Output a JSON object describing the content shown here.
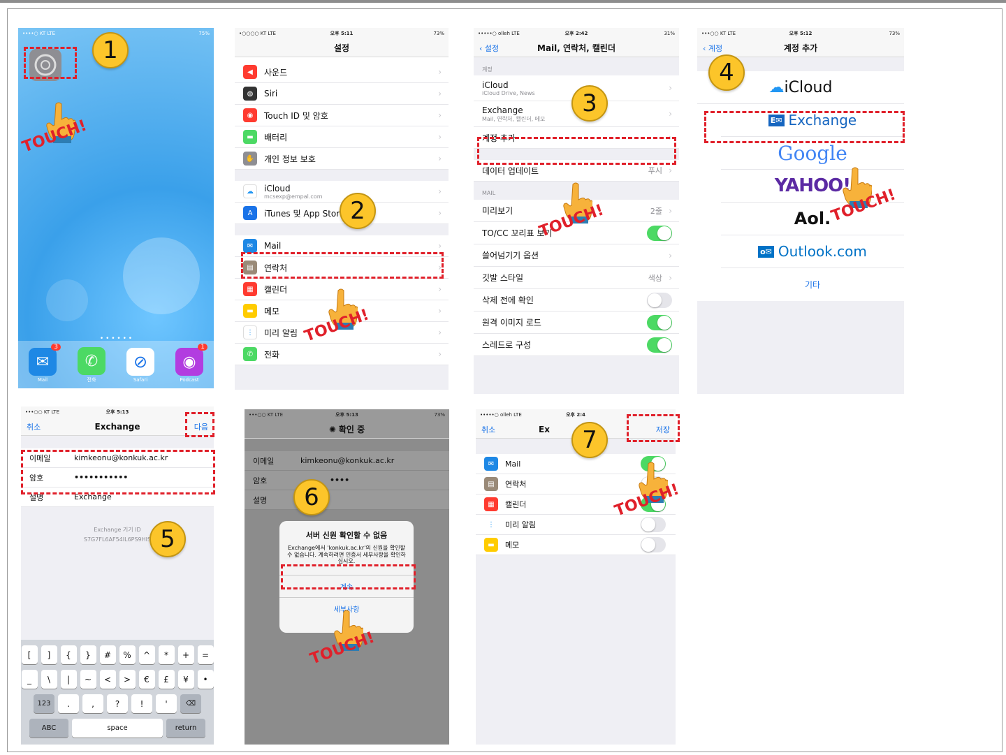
{
  "steps": [
    "1",
    "2",
    "3",
    "4",
    "5",
    "6",
    "7"
  ],
  "touch_label": "TOUCH!",
  "home": {
    "carrier": "••••○ KT  LTE",
    "battery": "75%",
    "settings_label": "설정",
    "dock": [
      {
        "name": "Mail",
        "badge": "3",
        "color": "#1e88e5"
      },
      {
        "name": "전화",
        "badge": "",
        "color": "#4cd964"
      },
      {
        "name": "Safari",
        "badge": "",
        "color": "#1a73e8"
      },
      {
        "name": "Podcast",
        "badge": "1",
        "color": "#b23ce0"
      }
    ]
  },
  "settings": {
    "carrier": "•○○○○ KT  LTE",
    "time": "오후 5:11",
    "battery": "73%",
    "title": "설정",
    "group1": [
      {
        "label": "사운드",
        "color": "#ff3b30",
        "icon": "◀"
      },
      {
        "label": "Siri",
        "color": "#333",
        "icon": "◍"
      },
      {
        "label": "Touch ID 및 암호",
        "color": "#ff3b30",
        "icon": "◉"
      },
      {
        "label": "배터리",
        "color": "#4cd964",
        "icon": "▬"
      },
      {
        "label": "개인 정보 보호",
        "color": "#8e8e93",
        "icon": "✋"
      }
    ],
    "group2": [
      {
        "label": "iCloud",
        "sub": "mcsexp@empal.com",
        "color": "#fff",
        "icon": "☁"
      },
      {
        "label": "iTunes 및 App Store",
        "sub": "",
        "color": "#1a73e8",
        "icon": "A"
      }
    ],
    "group3": [
      {
        "label": "Mail",
        "color": "#1e88e5",
        "icon": "✉"
      },
      {
        "label": "연락처",
        "color": "#9a8a78",
        "icon": "▤"
      },
      {
        "label": "캘린더",
        "color": "#ff3b30",
        "icon": "▦"
      },
      {
        "label": "메모",
        "color": "#ffcc00",
        "icon": "▬"
      },
      {
        "label": "미리 알림",
        "color": "#fff",
        "icon": "⋮"
      },
      {
        "label": "전화",
        "color": "#4cd964",
        "icon": "✆"
      }
    ]
  },
  "mail": {
    "carrier": "•••••○ olleh  LTE",
    "time": "오후 2:42",
    "battery": "31%",
    "back": "설정",
    "title": "Mail, 연락처, 캘린더",
    "accounts_header": "계정",
    "accounts": [
      {
        "label": "iCloud",
        "sub": "iCloud Drive, News"
      },
      {
        "label": "Exchange",
        "sub": "Mail, 연락처, 캘린더, 메모"
      },
      {
        "label": "계정 추가",
        "sub": ""
      }
    ],
    "fetch": {
      "label": "데이터 업데이트",
      "value": "푸시"
    },
    "mail_header": "MAIL",
    "mail_rows": [
      {
        "label": "미리보기",
        "value": "2줄",
        "toggle": ""
      },
      {
        "label": "TO/CC 꼬리표 보기",
        "value": "",
        "toggle": "on"
      },
      {
        "label": "쓸어넘기기 옵션",
        "value": "",
        "toggle": ""
      },
      {
        "label": "깃발 스타일",
        "value": "색상",
        "toggle": ""
      },
      {
        "label": "삭제 전에 확인",
        "value": "",
        "toggle": "off"
      },
      {
        "label": "원격 이미지 로드",
        "value": "",
        "toggle": "on"
      },
      {
        "label": "스레드로 구성",
        "value": "",
        "toggle": "on"
      }
    ]
  },
  "add_account": {
    "carrier": "•••○○ KT  LTE",
    "time": "오후 5:12",
    "battery": "73%",
    "back": "계정",
    "title": "계정 추가",
    "providers": [
      "iCloud",
      "Exchange",
      "Google",
      "YAHOO!",
      "Aol.",
      "Outlook.com",
      "기타"
    ]
  },
  "exchange_form": {
    "carrier": "•••○○ KT  LTE",
    "time": "오후 5:13",
    "cancel": "취소",
    "title": "Exchange",
    "next": "다음",
    "email_label": "이메일",
    "email_value": "kimkeonu@konkuk.ac.kr",
    "password_label": "암호",
    "password_value": "•••••••••••",
    "desc_label": "설명",
    "desc_value": "Exchange",
    "device_id_label": "Exchange 기기 ID",
    "device_id": "S7G7FL6AF54IL6PS9HIS",
    "keyboard": {
      "row1": [
        "[",
        "]",
        "{",
        "}",
        "#",
        "%",
        "^",
        "*",
        "+",
        "="
      ],
      "row2": [
        "_",
        "\\",
        "|",
        "~",
        "<",
        ">",
        "€",
        "£",
        "¥",
        "•"
      ],
      "row3": [
        "123",
        ".",
        ",",
        "?",
        "!",
        "'",
        "⌫"
      ],
      "abc": "ABC",
      "space": "space",
      "return": "return"
    }
  },
  "verify": {
    "carrier": "•••○○ KT  LTE",
    "time": "오후 5:13",
    "battery": "73%",
    "title": "확인 중",
    "email_label": "이메일",
    "email_value": "kimkeonu@konkuk.ac.kr",
    "password_label": "암호",
    "password_value": "••••",
    "desc_label": "설명",
    "alert_title": "서버 신원 확인할 수 없음",
    "alert_msg": "Exchange에서 'konkuk.ac.kr'의 신원을 확인할 수 없습니다. 계속하려면 인증서 세부사항을 확인하십시오.",
    "alert_continue": "계속",
    "alert_details": "세부사항"
  },
  "sync": {
    "carrier": "•••••○ olleh  LTE",
    "time": "오후 2:4",
    "cancel": "취소",
    "title": "Ex",
    "save": "저장",
    "rows": [
      {
        "label": "Mail",
        "color": "#1e88e5",
        "icon": "✉",
        "on": true
      },
      {
        "label": "연락처",
        "color": "#9a8a78",
        "icon": "▤",
        "on": false
      },
      {
        "label": "캘린더",
        "color": "#ff3b30",
        "icon": "▦",
        "on": true
      },
      {
        "label": "미리 알림",
        "color": "#fff",
        "icon": "⋮",
        "on": false
      },
      {
        "label": "메모",
        "color": "#ffcc00",
        "icon": "▬",
        "on": false
      }
    ]
  }
}
